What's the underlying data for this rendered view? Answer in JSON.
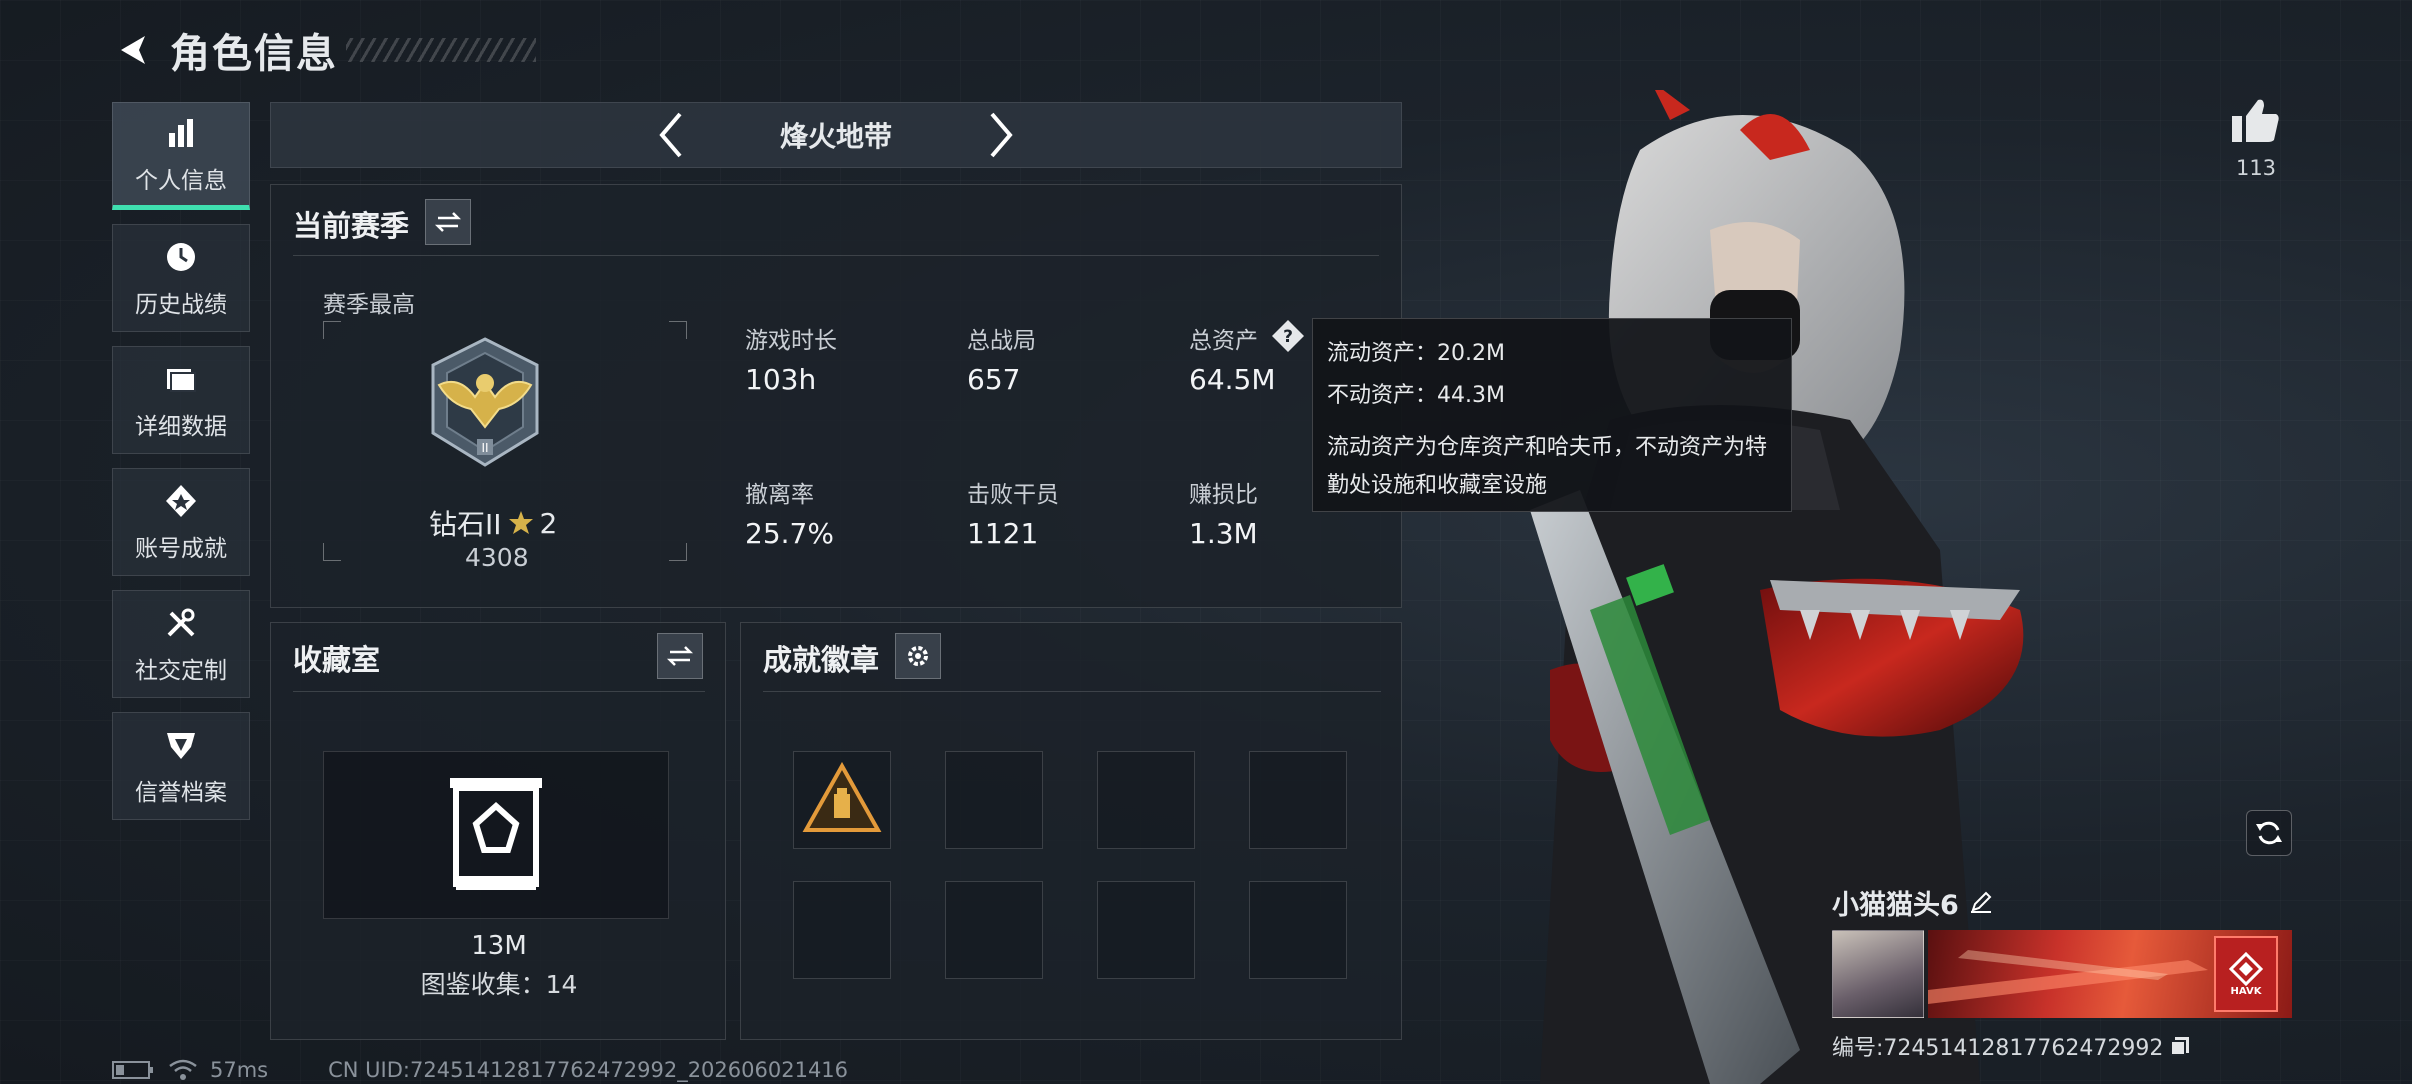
{
  "header": {
    "title": "角色信息"
  },
  "sidebar": {
    "items": [
      {
        "label": "个人信息",
        "icon": "bar-chart-icon",
        "active": true
      },
      {
        "label": "历史战绩",
        "icon": "history-icon",
        "active": false
      },
      {
        "label": "详细数据",
        "icon": "folder-icon",
        "active": false
      },
      {
        "label": "账号成就",
        "icon": "achievement-icon",
        "active": false
      },
      {
        "label": "社交定制",
        "icon": "tools-icon",
        "active": false
      },
      {
        "label": "信誉档案",
        "icon": "reputation-icon",
        "active": false
      }
    ]
  },
  "mode": {
    "name": "烽火地带"
  },
  "season": {
    "title": "当前赛季",
    "best_label": "赛季最高",
    "rank_name": "钻石II",
    "rank_stars": "2",
    "rank_score": "4308",
    "stats": [
      {
        "label": "游戏时长",
        "value": "103h"
      },
      {
        "label": "总战局",
        "value": "657"
      },
      {
        "label": "总资产",
        "value": "64.5M"
      },
      {
        "label": "撤离率",
        "value": "25.7%"
      },
      {
        "label": "击败干员",
        "value": "1121"
      },
      {
        "label": "赚损比",
        "value": "1.3M"
      }
    ]
  },
  "tooltip": {
    "line1": "流动资产：20.2M",
    "line2": "不动资产：44.3M",
    "desc": "流动资产为仓库资产和哈夫币，不动资产为特勤处设施和收藏室设施"
  },
  "collection": {
    "title": "收藏室",
    "value": "13M",
    "catalog": "图鉴收集：14"
  },
  "badges": {
    "title": "成就徽章"
  },
  "player": {
    "likes": "113",
    "name": "小猫猫头6",
    "id": "编号:72451412817762472992",
    "banner_logo_text": "HAVK"
  },
  "status": {
    "ping": "57ms",
    "uid": "CN UID:72451412817762472992_202606021416"
  },
  "colors": {
    "accent": "#3fe0b0",
    "gold": "#d6b24a"
  }
}
